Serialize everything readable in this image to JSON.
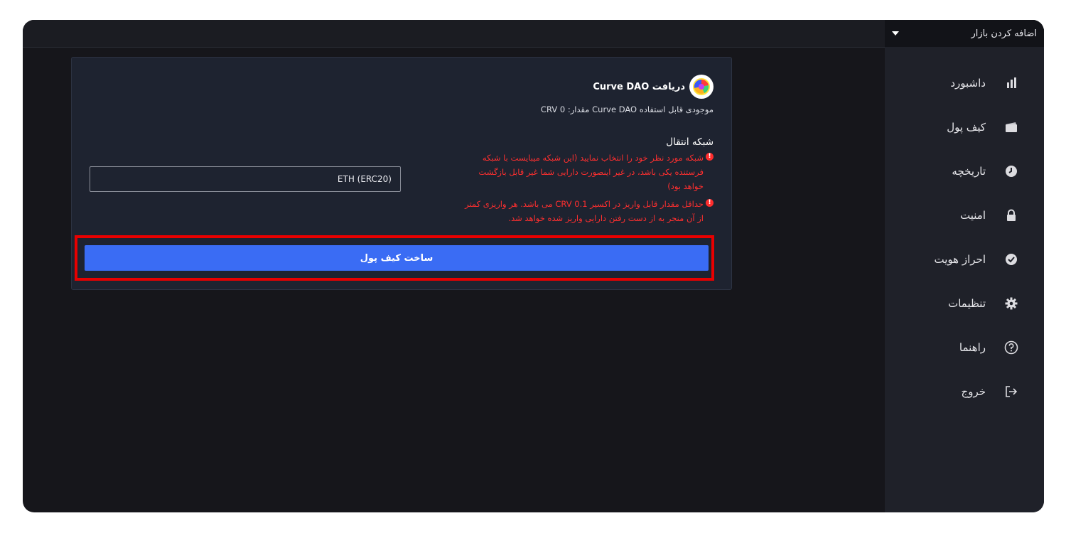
{
  "header": {
    "market_label": "اضافه کردن بازار"
  },
  "sidebar": {
    "items": [
      {
        "label": "داشبورد",
        "icon": "bar-chart-icon"
      },
      {
        "label": "کیف پول",
        "icon": "wallet-icon"
      },
      {
        "label": "تاریخچه",
        "icon": "clock-icon"
      },
      {
        "label": "امنیت",
        "icon": "lock-icon"
      },
      {
        "label": "احراز هویت",
        "icon": "check-badge-icon"
      },
      {
        "label": "تنظیمات",
        "icon": "gear-icon"
      },
      {
        "label": "راهنما",
        "icon": "help-icon"
      },
      {
        "label": "خروج",
        "icon": "logout-icon"
      }
    ]
  },
  "deposit": {
    "title": "دریافت Curve DAO",
    "balance_text": "موجودی قابل استفاده Curve DAO مقدار: 0 CRV",
    "network_title": "شبکه انتقال",
    "warnings": [
      "شبکه مورد نظر خود را انتخاب نمایید (این شبکه میبایست با شبکه فرستنده یکی باشد، در غیر اینصورت دارایی شما غیر قابل بازگشت خواهد بود)",
      "حداقل مقدار قابل واریز در اکسیر CRV 0.1 می باشد. هر واریزی کمتر از آن منجر به از دست رفتن دارایی واریز شده خواهد شد."
    ],
    "network_value": "ETH (ERC20)",
    "create_wallet_label": "ساخت کیف پول"
  },
  "colors": {
    "accent": "#3a6cf4",
    "warning": "#ff2f2f",
    "highlight": "#e80000",
    "sidebar_bg": "#1f2129",
    "main_bg": "#16161b"
  }
}
